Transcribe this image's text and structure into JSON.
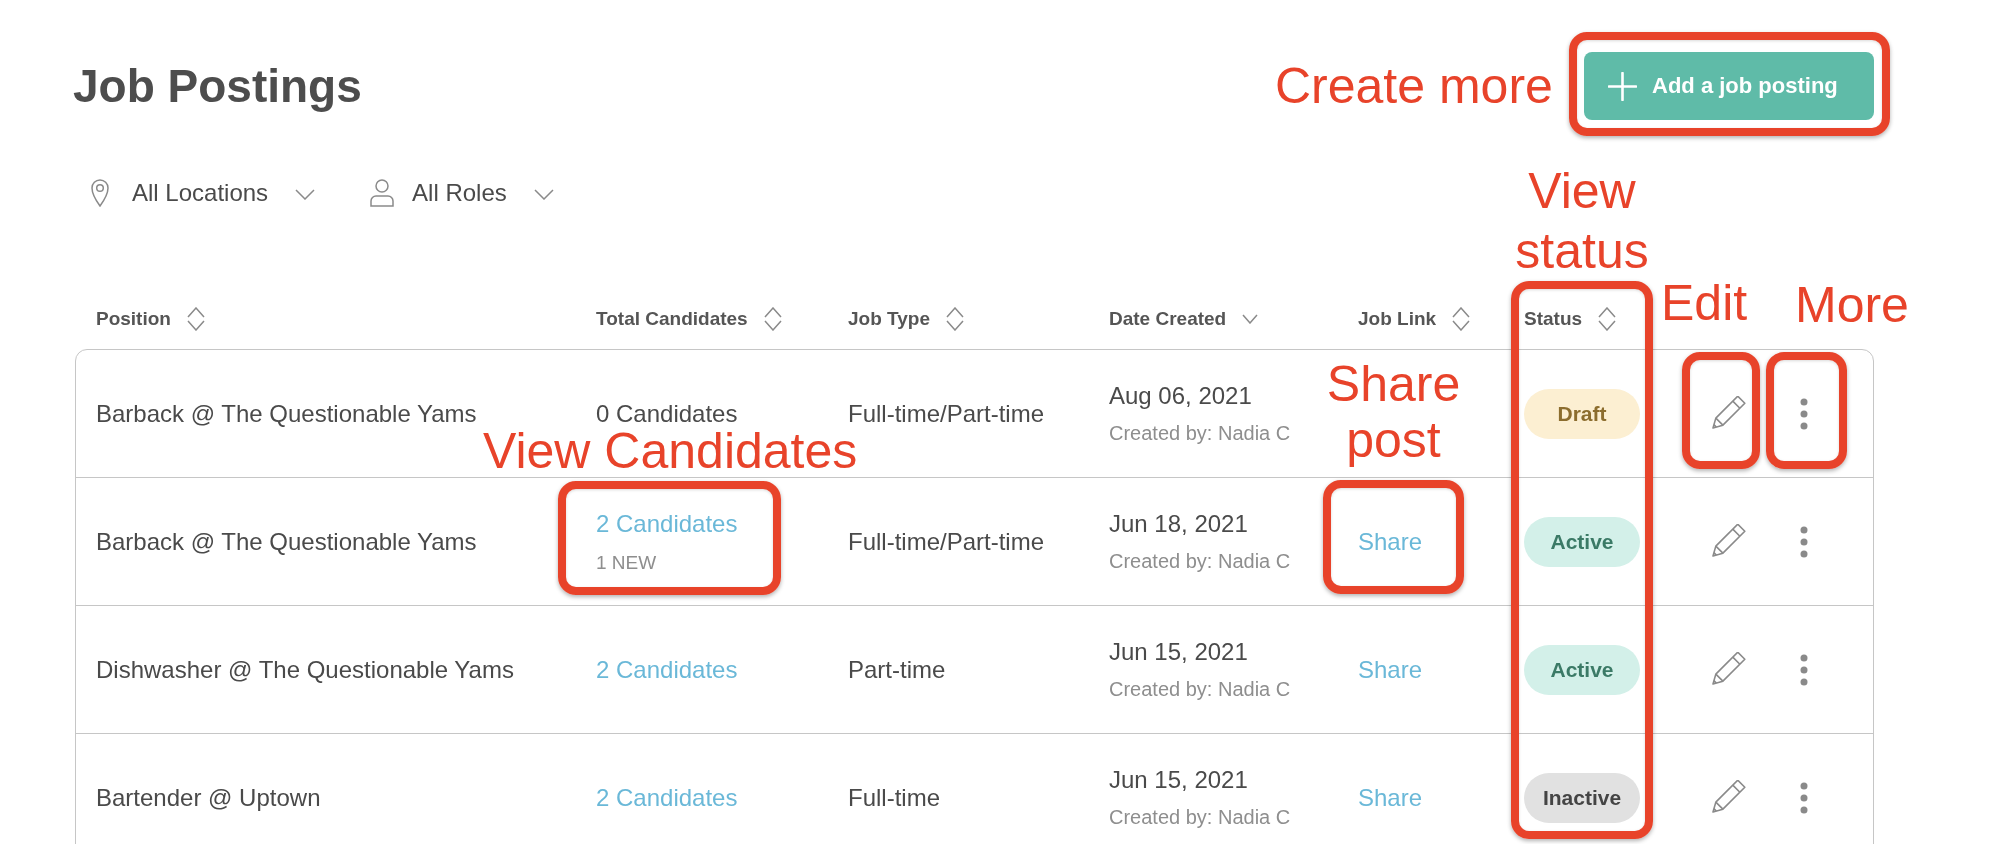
{
  "page": {
    "title": "Job Postings",
    "add_button": "Add a job posting"
  },
  "filters": [
    {
      "kind": "location",
      "label": "All Locations"
    },
    {
      "kind": "role",
      "label": "All Roles"
    }
  ],
  "table": {
    "columns": [
      {
        "label": "Position",
        "sorted": false
      },
      {
        "label": "Total Candidates",
        "sorted": false
      },
      {
        "label": "Job Type",
        "sorted": false
      },
      {
        "label": "Date Created",
        "sorted": true
      },
      {
        "label": "Job Link",
        "sorted": false
      },
      {
        "label": "Status",
        "sorted": false
      }
    ],
    "rows": [
      {
        "position": "Barback @ The Questionable Yams",
        "candidates": {
          "text": "0 Candidates",
          "link": false
        },
        "job_type": "Full-time/Part-time",
        "date": "Aug 06, 2021",
        "created_by": "Created by: Nadia C",
        "status": {
          "label": "Draft",
          "kind": "draft"
        }
      },
      {
        "position": "Barback @ The Questionable Yams",
        "candidates": {
          "text": "2 Candidates",
          "link": true
        },
        "new_count": "1 NEW",
        "job_type": "Full-time/Part-time",
        "date": "Jun 18, 2021",
        "created_by": "Created by: Nadia C",
        "job_link": "Share",
        "status": {
          "label": "Active",
          "kind": "active"
        }
      },
      {
        "position": "Dishwasher @ The Questionable Yams",
        "candidates": {
          "text": "2 Candidates",
          "link": true
        },
        "job_type": "Part-time",
        "date": "Jun 15, 2021",
        "created_by": "Created by: Nadia C",
        "job_link": "Share",
        "status": {
          "label": "Active",
          "kind": "active"
        }
      },
      {
        "position": "Bartender @ Uptown",
        "candidates": {
          "text": "2 Candidates",
          "link": true
        },
        "job_type": "Full-time",
        "date": "Jun 15, 2021",
        "created_by": "Created by: Nadia C",
        "job_link": "Share",
        "status": {
          "label": "Inactive",
          "kind": "inactive"
        }
      }
    ]
  },
  "annotations": [
    {
      "label": "Create more"
    },
    {
      "label": "View status"
    },
    {
      "label": "Edit"
    },
    {
      "label": "More"
    },
    {
      "label": "Share post"
    },
    {
      "label": "View Candidates"
    }
  ]
}
